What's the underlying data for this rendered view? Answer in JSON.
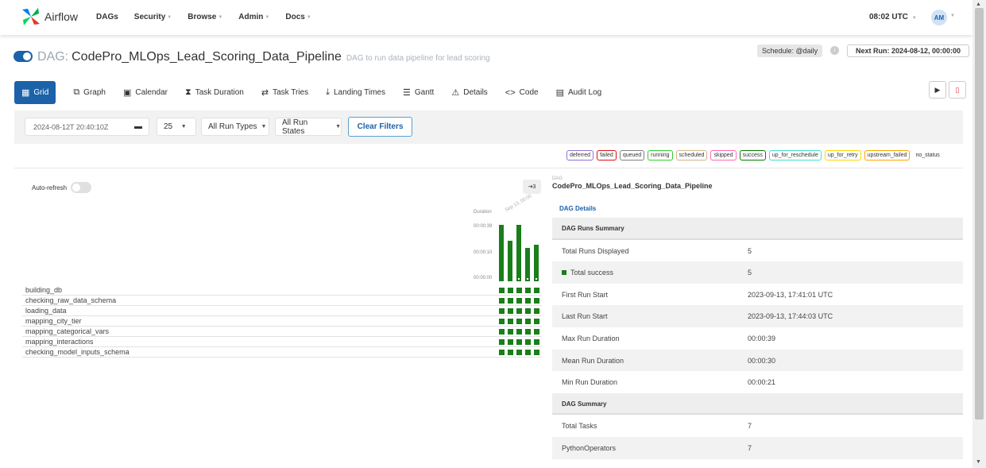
{
  "nav": {
    "brand": "Airflow",
    "items": [
      "DAGs",
      "Security",
      "Browse",
      "Admin",
      "Docs"
    ],
    "time": "08:02 UTC",
    "avatar": "AM"
  },
  "dag": {
    "prefix": "DAG:",
    "name": "CodePro_MLOps_Lead_Scoring_Data_Pipeline",
    "description": "DAG to run data pipeline for lead scoring",
    "schedule": "Schedule: @daily",
    "next_run": "Next Run: 2024-08-12, 00:00:00"
  },
  "tabs": [
    {
      "label": "Grid",
      "icon": "grid-icon"
    },
    {
      "label": "Graph",
      "icon": "graph-icon"
    },
    {
      "label": "Calendar",
      "icon": "calendar-icon"
    },
    {
      "label": "Task Duration",
      "icon": "hourglass-icon"
    },
    {
      "label": "Task Tries",
      "icon": "retry-icon"
    },
    {
      "label": "Landing Times",
      "icon": "landing-icon"
    },
    {
      "label": "Gantt",
      "icon": "gantt-icon"
    },
    {
      "label": "Details",
      "icon": "warning-icon"
    },
    {
      "label": "Code",
      "icon": "code-icon"
    },
    {
      "label": "Audit Log",
      "icon": "audit-log-icon"
    }
  ],
  "filters": {
    "date": "2024-08-12T 20:40:10Z",
    "num_runs": "25",
    "run_types": "All Run Types",
    "run_states": "All Run States",
    "clear": "Clear Filters"
  },
  "legend": [
    {
      "label": "deferred",
      "color": "#9370db"
    },
    {
      "label": "failed",
      "color": "#d11"
    },
    {
      "label": "queued",
      "color": "#808080"
    },
    {
      "label": "running",
      "color": "#32cd32"
    },
    {
      "label": "scheduled",
      "color": "#d2b48c"
    },
    {
      "label": "skipped",
      "color": "#ff69b4"
    },
    {
      "label": "success",
      "color": "#008000"
    },
    {
      "label": "up_for_reschedule",
      "color": "#40e0d0"
    },
    {
      "label": "up_for_retry",
      "color": "#ffd700"
    },
    {
      "label": "upstream_failed",
      "color": "#ffa500"
    },
    {
      "label": "no_status",
      "color": ""
    }
  ],
  "grid": {
    "auto_refresh": "Auto-refresh",
    "collapse": "⇥3",
    "duration_label": "Duration",
    "run_label": "Sep 13, 00:00",
    "yticks": [
      "00:00:39",
      "00:00:10",
      "00:00:00"
    ],
    "run_durations_sec": [
      39,
      28,
      39,
      23,
      25
    ],
    "tasks": [
      "building_db",
      "checking_raw_data_schema",
      "loading_data",
      "mapping_city_tier",
      "mapping_categorical_vars",
      "mapping_interactions",
      "checking_model_inputs_schema"
    ]
  },
  "details": {
    "dag_small": "DAG",
    "dag_name": "CodePro_MLOps_Lead_Scoring_Data_Pipeline",
    "dag_details": "DAG Details",
    "rows": [
      {
        "type": "section",
        "k": "DAG Runs Summary",
        "v": ""
      },
      {
        "type": "row",
        "k": "Total Runs Displayed",
        "v": "5"
      },
      {
        "type": "success",
        "k": "Total success",
        "v": "5"
      },
      {
        "type": "row",
        "k": "First Run Start",
        "v": "2023-09-13, 17:41:01 UTC"
      },
      {
        "type": "row",
        "k": "Last Run Start",
        "v": "2023-09-13, 17:44:03 UTC"
      },
      {
        "type": "row",
        "k": "Max Run Duration",
        "v": "00:00:39"
      },
      {
        "type": "row",
        "k": "Mean Run Duration",
        "v": "00:00:30"
      },
      {
        "type": "row",
        "k": "Min Run Duration",
        "v": "00:00:21"
      },
      {
        "type": "section",
        "k": "DAG Summary",
        "v": ""
      },
      {
        "type": "row",
        "k": "Total Tasks",
        "v": "7"
      },
      {
        "type": "row",
        "k": "PythonOperators",
        "v": "7"
      }
    ]
  }
}
